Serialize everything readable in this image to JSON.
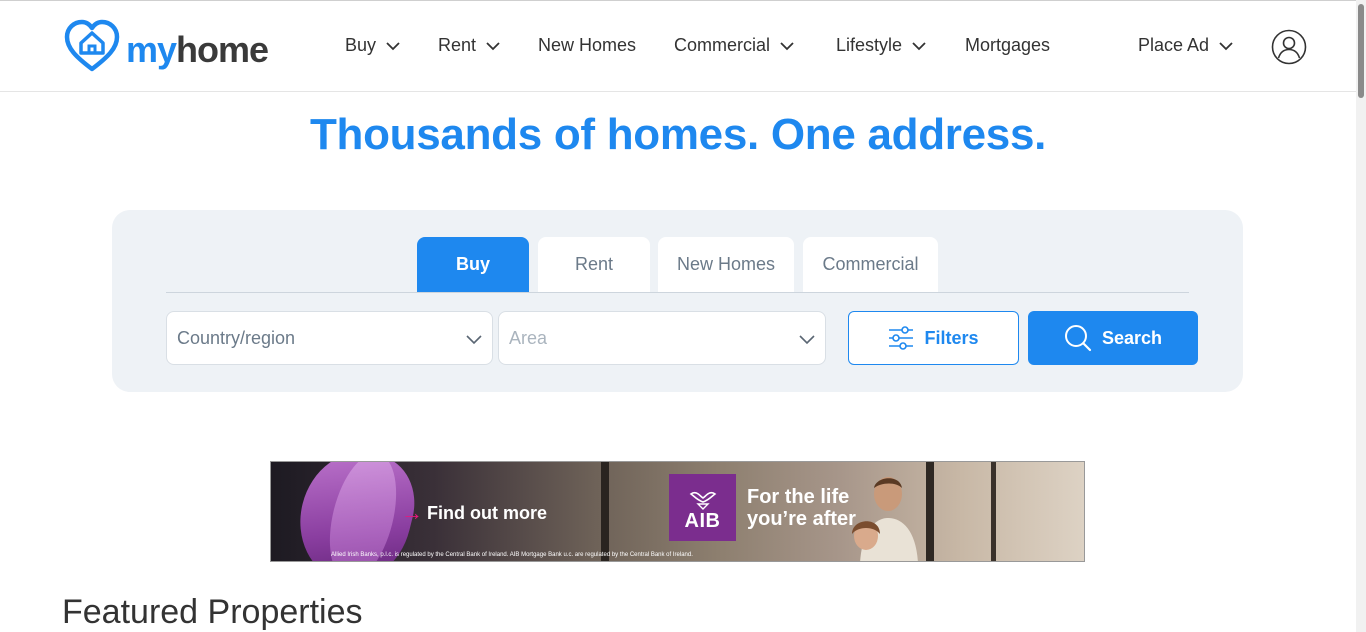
{
  "brand": {
    "my": "my",
    "home": "home",
    "accent": "#1e88ef"
  },
  "nav": {
    "items": [
      {
        "label": "Buy",
        "has_menu": true
      },
      {
        "label": "Rent",
        "has_menu": true
      },
      {
        "label": "New Homes",
        "has_menu": false
      },
      {
        "label": "Commercial",
        "has_menu": true
      },
      {
        "label": "Lifestyle",
        "has_menu": true
      },
      {
        "label": "Mortgages",
        "has_menu": false
      }
    ],
    "place_ad": "Place Ad",
    "user_icon": "user-icon"
  },
  "hero": {
    "title": "Thousands of homes. One address."
  },
  "search": {
    "tabs": [
      {
        "label": "Buy",
        "active": true
      },
      {
        "label": "Rent",
        "active": false
      },
      {
        "label": "New Homes",
        "active": false
      },
      {
        "label": "Commercial",
        "active": false
      }
    ],
    "country_placeholder": "Country/region",
    "area_placeholder": "Area",
    "filters_label": "Filters",
    "search_label": "Search"
  },
  "banner": {
    "cta": "Find out more",
    "logo_text": "AIB",
    "tagline_line1": "For the life",
    "tagline_line2": "you’re after",
    "legal": "Allied Irish Banks, p.l.c. is regulated by the Central Bank of Ireland. AIB Mortgage Bank u.c. are regulated by the Central Bank of Ireland."
  },
  "featured": {
    "title": "Featured Properties"
  }
}
